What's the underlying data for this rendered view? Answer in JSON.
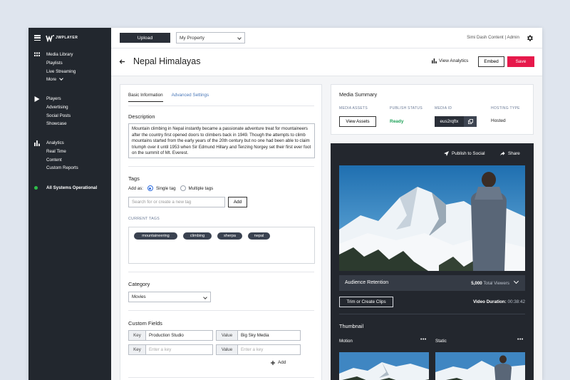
{
  "sidebar": {
    "brand": "JWPLAYER",
    "group1": [
      "Media Library",
      "Playlists",
      "Live Streaming"
    ],
    "more_label": "More",
    "group2": [
      "Players",
      "Advertising",
      "Social Posts",
      "Showcase"
    ],
    "group3": [
      "Analytics",
      "Real Time",
      "Content",
      "Custom Reports"
    ],
    "status": "All Systems Operational",
    "status_color": "#2fbf4a"
  },
  "topbar": {
    "upload_label": "Upload",
    "property_value": "My Property",
    "account": "Simi Dash Content | Admin"
  },
  "header": {
    "title": "Nepal Himalayas",
    "view_analytics": "View Analytics",
    "embed": "Embed",
    "save": "Save",
    "save_color": "#e6194b"
  },
  "left": {
    "tabs": [
      "Basic Information",
      "Advanced Settings"
    ],
    "description_title": "Description",
    "description": "Mountain climbing in Nepal instantly became a passionate adventure treat for mountaineers after the country first opened doors to climbers back in 1949. Though the attempts to climb mountains started from the early years of the 20th century but no one had been able to claim triumph over it until 1953 when Sir Edmund Hillary and Tenzing Norgey set their first ever foot on the summit of Mt. Everest.",
    "tags_title": "Tags",
    "add_as": "Add as:",
    "single_tag": "Single tag",
    "multiple_tags": "Multiple tags",
    "tag_placeholder": "Search for or create a new tag",
    "add_button": "Add",
    "current_tags_label": "CURRENT TAGS",
    "current_tags": [
      "mountaineering",
      "climbing",
      "sherpa",
      "nepal"
    ],
    "category_title": "Category",
    "category_value": "Movies",
    "custom_fields_title": "Custom Fields",
    "key_label": "Key",
    "value_label": "Value",
    "field1_key": "Production Studio",
    "field1_value": "Big Sky Media",
    "key_placeholder": "Enter a key",
    "value_placeholder": "Enter a key",
    "add_field": "Add"
  },
  "summary": {
    "title": "Media Summary",
    "col_assets": "MEDIA ASSETS",
    "col_status": "PUBLISH STATUS",
    "col_id": "MEDIA ID",
    "col_hosting": "HOSTING TYPE",
    "view_assets": "View Assets",
    "status": "Ready",
    "status_color": "#20a35a",
    "media_id": "eus2rqftx",
    "hosting": "Hosted"
  },
  "player": {
    "publish_social": "Publish to Social",
    "share": "Share",
    "retention_title": "Audience Retention",
    "viewers_count": "5,000",
    "viewers_label": "Total Viewers",
    "trim_button": "Trim or Create Clips",
    "duration_label": "Video Duration:",
    "duration_value": "00:38:42",
    "thumbnail_title": "Thumbnail",
    "motion_label": "Motion",
    "static_label": "Static",
    "dots": "•••"
  }
}
